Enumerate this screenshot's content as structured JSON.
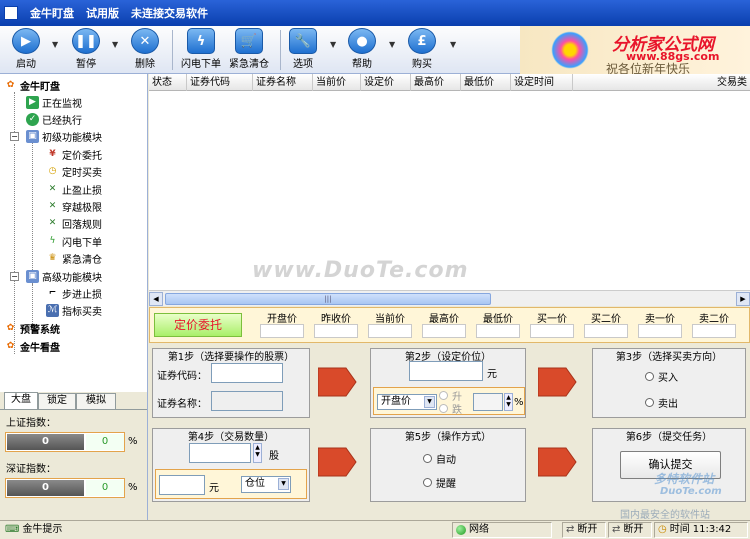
{
  "window": {
    "app_name": "金牛盯盘",
    "edition": "试用版",
    "connection_status": "未连接交易软件"
  },
  "toolbar": {
    "buttons": [
      {
        "label": "启动",
        "icon": "play-icon"
      },
      {
        "label": "暂停",
        "icon": "pause-icon"
      },
      {
        "label": "删除",
        "icon": "delete-icon"
      },
      {
        "label": "闪电下单",
        "icon": "lightning-icon"
      },
      {
        "label": "紧急清仓",
        "icon": "cart-icon"
      },
      {
        "label": "选项",
        "icon": "wrench-icon"
      },
      {
        "label": "帮助",
        "icon": "person-icon"
      },
      {
        "label": "购买",
        "icon": "pound-icon"
      }
    ]
  },
  "banner": {
    "watermark_title": "分析家公式网",
    "watermark_url": "www.88gs.com",
    "greeting": "祝各位新年快乐"
  },
  "sidebar": {
    "root": "金牛盯盘",
    "watching": "正在监视",
    "executed": "已经执行",
    "basic_module": "初级功能模块",
    "basic_items": [
      "定价委托",
      "定时买卖",
      "止盈止损",
      "穿越极限",
      "回落规则",
      "闪电下单",
      "紧急清仓"
    ],
    "advanced_module": "高级功能模块",
    "advanced_items": [
      "步进止损",
      "指标买卖"
    ],
    "alert_system": "预警系统",
    "market_view": "金牛看盘"
  },
  "grid": {
    "columns": [
      "状态",
      "证券代码",
      "证券名称",
      "当前价",
      "设定价",
      "最高价",
      "最低价",
      "设定时间",
      "交易类"
    ]
  },
  "quote_row": {
    "mode_button": "定价委托",
    "labels": [
      "开盘价",
      "昨收价",
      "当前价",
      "最高价",
      "最低价",
      "买一价",
      "买二价",
      "卖一价",
      "卖二价"
    ]
  },
  "steps": {
    "step1": {
      "title": "第1步（选择要操作的股票）",
      "code_label": "证券代码：",
      "name_label": "证券名称："
    },
    "step2": {
      "title": "第2步（设定价位）",
      "unit": "元",
      "price_type": "开盘价",
      "rise": "升",
      "fall": "跌",
      "percent": "%"
    },
    "step3": {
      "title": "第3步（选择买卖方向）",
      "buy": "买入",
      "sell": "卖出"
    },
    "step4": {
      "title": "第4步（交易数量）",
      "shares_unit": "股",
      "money_unit": "元",
      "position_select": "仓位"
    },
    "step5": {
      "title": "第5步（操作方式）",
      "auto": "自动",
      "remind": "提醒"
    },
    "step6": {
      "title": "第6步（提交任务）",
      "confirm": "确认提交"
    }
  },
  "left_panel": {
    "tabs": [
      "大盘",
      "锁定",
      "模拟"
    ],
    "sh_label": "上证指数：",
    "sh_value": "0",
    "sh_pct": "0",
    "sz_label": "深证指数：",
    "sz_value": "0",
    "sz_pct": "0",
    "percent": "%"
  },
  "watermarks": {
    "duote": "www.DuoTe.com",
    "duote_small": "多特软件站",
    "duote_site": "DuoTe.com",
    "safe_site": "国内最安全的软件站"
  },
  "statusbar": {
    "hint": "金牛提示",
    "network": "网络",
    "disconnect1": "断开",
    "disconnect2": "断开",
    "time_label": "时间",
    "time": "11:3:42"
  },
  "colors": {
    "titlebar": "#0a3fae",
    "accent_red": "#e8152b",
    "quote_bg": "#fff6d8",
    "step_arrow": "#d94a2a"
  }
}
